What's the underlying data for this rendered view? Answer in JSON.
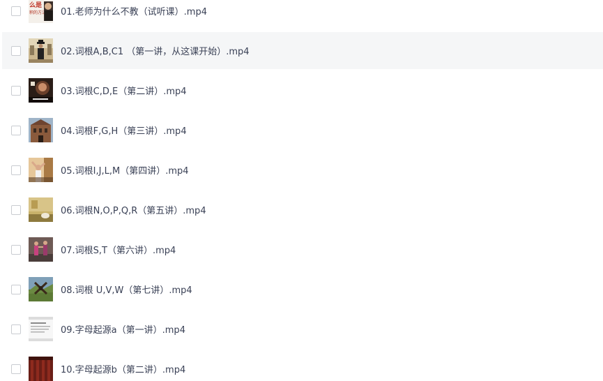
{
  "files": [
    {
      "name": "01.老师为什么不教（试听课）.mp4",
      "thumb": "thumb-title-card"
    },
    {
      "name": "02.词根A,B,C1 （第一讲，从这课开始）.mp4",
      "thumb": "thumb-man-in-hat"
    },
    {
      "name": "03.词根C,D,E（第二讲）.mp4",
      "thumb": "thumb-dark-scene"
    },
    {
      "name": "04.词根F,G,H（第三讲）.mp4",
      "thumb": "thumb-building"
    },
    {
      "name": "05.词根I,J,L,M（第四讲）.mp4",
      "thumb": "thumb-person-arms-up"
    },
    {
      "name": "06.词根N,O,P,Q,R（第五讲）.mp4",
      "thumb": "thumb-room"
    },
    {
      "name": "07.词根S,T（第六讲）.mp4",
      "thumb": "thumb-dancers"
    },
    {
      "name": "08.词根 U,V,W（第七讲）.mp4",
      "thumb": "thumb-landscape"
    },
    {
      "name": "09.字母起源a（第一讲）.mp4",
      "thumb": "thumb-slide"
    },
    {
      "name": "10.字母起源b（第二讲）.mp4",
      "thumb": "thumb-red-curtain"
    }
  ],
  "thumb_titles": {
    "t1_line1": "么是",
    "t1_line2": "积的方法"
  },
  "hovered_row": 1
}
